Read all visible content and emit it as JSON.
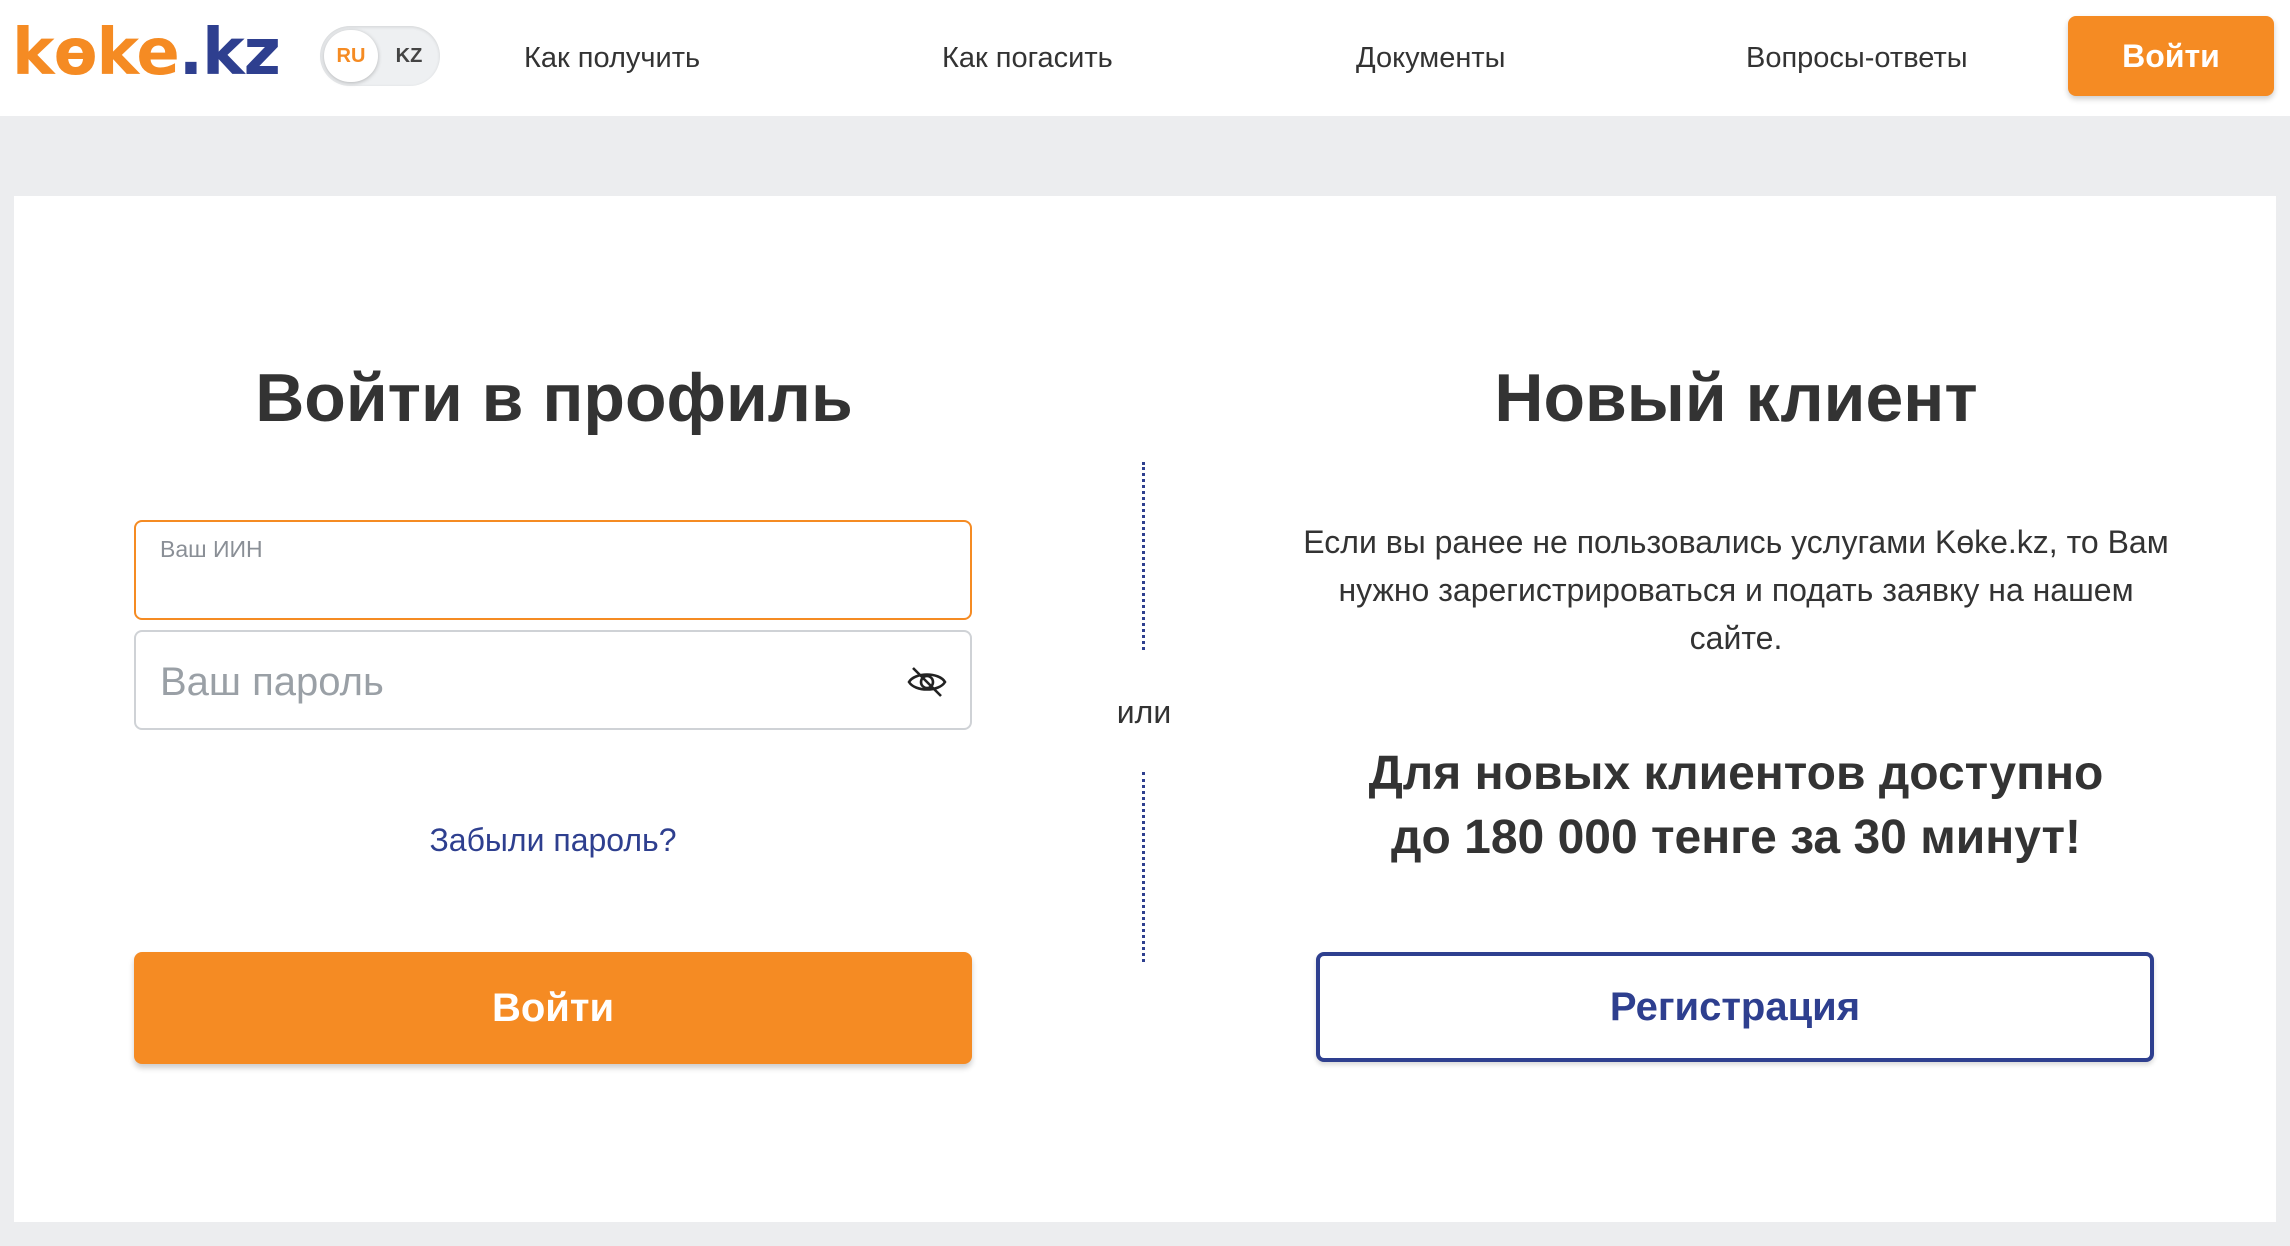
{
  "header": {
    "logo": {
      "part1": "kөke",
      "part2": ".kz"
    },
    "lang": {
      "ru": "RU",
      "kz": "KZ",
      "active": "RU"
    },
    "nav": [
      {
        "label": "Как получить"
      },
      {
        "label": "Как погасить"
      },
      {
        "label": "Документы"
      },
      {
        "label": "Вопросы-ответы"
      }
    ],
    "login_button": "Войти"
  },
  "login": {
    "title": "Войти в профиль",
    "iin_label": "Ваш ИИН",
    "iin_value": "",
    "password_placeholder": "Ваш пароль",
    "forgot": "Забыли пароль?",
    "submit": "Войти"
  },
  "separator": {
    "text": "или"
  },
  "register": {
    "title": "Новый клиент",
    "description": "Если вы ранее не пользовались услугами Kөke.kz, то Вам нужно зарегистрироваться и подать заявку на нашем сайте.",
    "promo_line1": "Для новых клиентов доступно",
    "promo_line2": "до 180 000 тенге за 30 минут!",
    "button": "Регистрация"
  },
  "colors": {
    "accent": "#f58b23",
    "brand": "#2e3f8f",
    "background": "#ecedef"
  },
  "icons": {
    "password_toggle": "eye-off-icon"
  }
}
